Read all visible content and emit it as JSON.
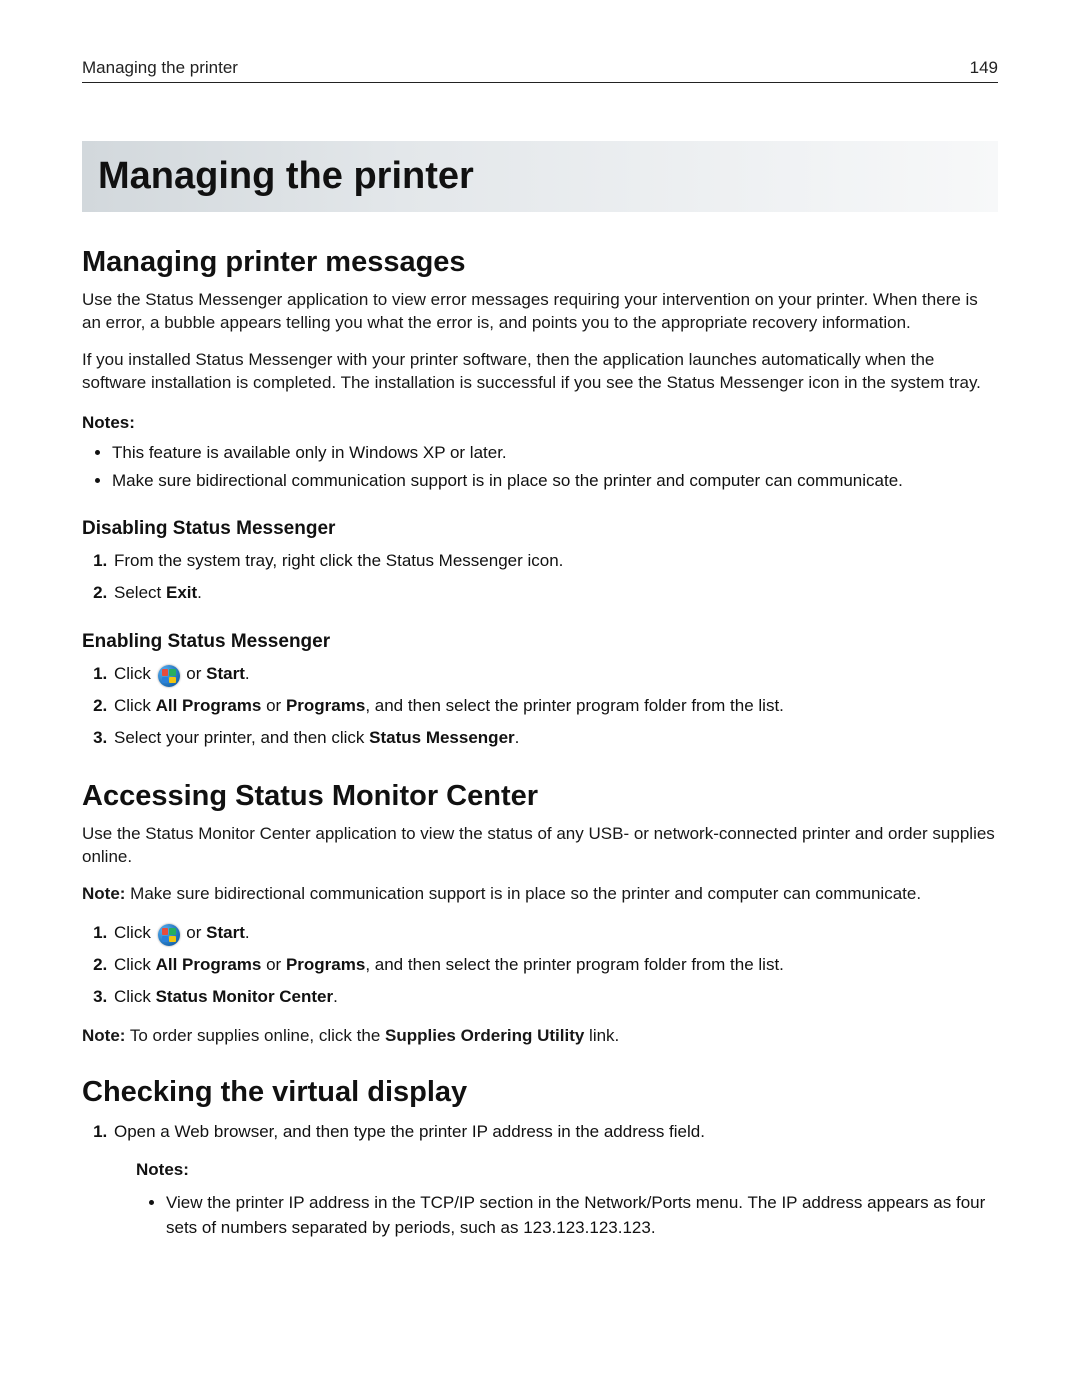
{
  "header": {
    "running_title": "Managing the printer",
    "page_number": "149"
  },
  "title": "Managing the printer",
  "section1": {
    "heading": "Managing printer messages",
    "p1": "Use the Status Messenger application to view error messages requiring your intervention on your printer. When there is an error, a bubble appears telling you what the error is, and points you to the appropriate recovery information.",
    "p2": "If you installed Status Messenger with your printer software, then the application launches automatically when the software installation is completed. The installation is successful if you see the Status Messenger icon in the system tray.",
    "notes_label": "Notes:",
    "notes": [
      "This feature is available only in Windows XP or later.",
      "Make sure bidirectional communication support is in place so the printer and computer can communicate."
    ],
    "sub1": {
      "heading": "Disabling Status Messenger",
      "steps": [
        {
          "text": "From the system tray, right click the Status Messenger icon."
        },
        {
          "prefix": "Select ",
          "b1": "Exit",
          "suffix": "."
        }
      ]
    },
    "sub2": {
      "heading": "Enabling Status Messenger",
      "steps": [
        {
          "prefix": "Click ",
          "has_icon": true,
          "mid": " or ",
          "b1": "Start",
          "suffix": "."
        },
        {
          "prefix": "Click ",
          "b1": "All Programs",
          "mid": " or ",
          "b2": "Programs",
          "suffix": ", and then select the printer program folder from the list."
        },
        {
          "prefix": "Select your printer, and then click ",
          "b1": "Status Messenger",
          "suffix": "."
        }
      ]
    }
  },
  "section2": {
    "heading": "Accessing Status Monitor Center",
    "p1": "Use the Status Monitor Center application to view the status of any USB‑ or network‑connected printer and order supplies online.",
    "note_label": "Note:",
    "note_text": " Make sure bidirectional communication support is in place so the printer and computer can communicate.",
    "steps": [
      {
        "prefix": "Click ",
        "has_icon": true,
        "mid": " or ",
        "b1": "Start",
        "suffix": "."
      },
      {
        "prefix": "Click ",
        "b1": "All Programs",
        "mid": " or ",
        "b2": "Programs",
        "suffix": ", and then select the printer program folder from the list."
      },
      {
        "prefix": "Click ",
        "b1": "Status Monitor Center",
        "suffix": "."
      }
    ],
    "note2_label": "Note:",
    "note2_prefix": " To order supplies online, click the ",
    "note2_b": "Supplies Ordering Utility",
    "note2_suffix": " link."
  },
  "section3": {
    "heading": "Checking the virtual display",
    "step1": "Open a Web browser, and then type the printer IP address in the address field.",
    "nested_notes_label": "Notes:",
    "nested_notes": [
      "View the printer IP address in the TCP/IP section in the Network/Ports menu. The IP address appears as four sets of numbers separated by periods, such as 123.123.123.123."
    ]
  }
}
